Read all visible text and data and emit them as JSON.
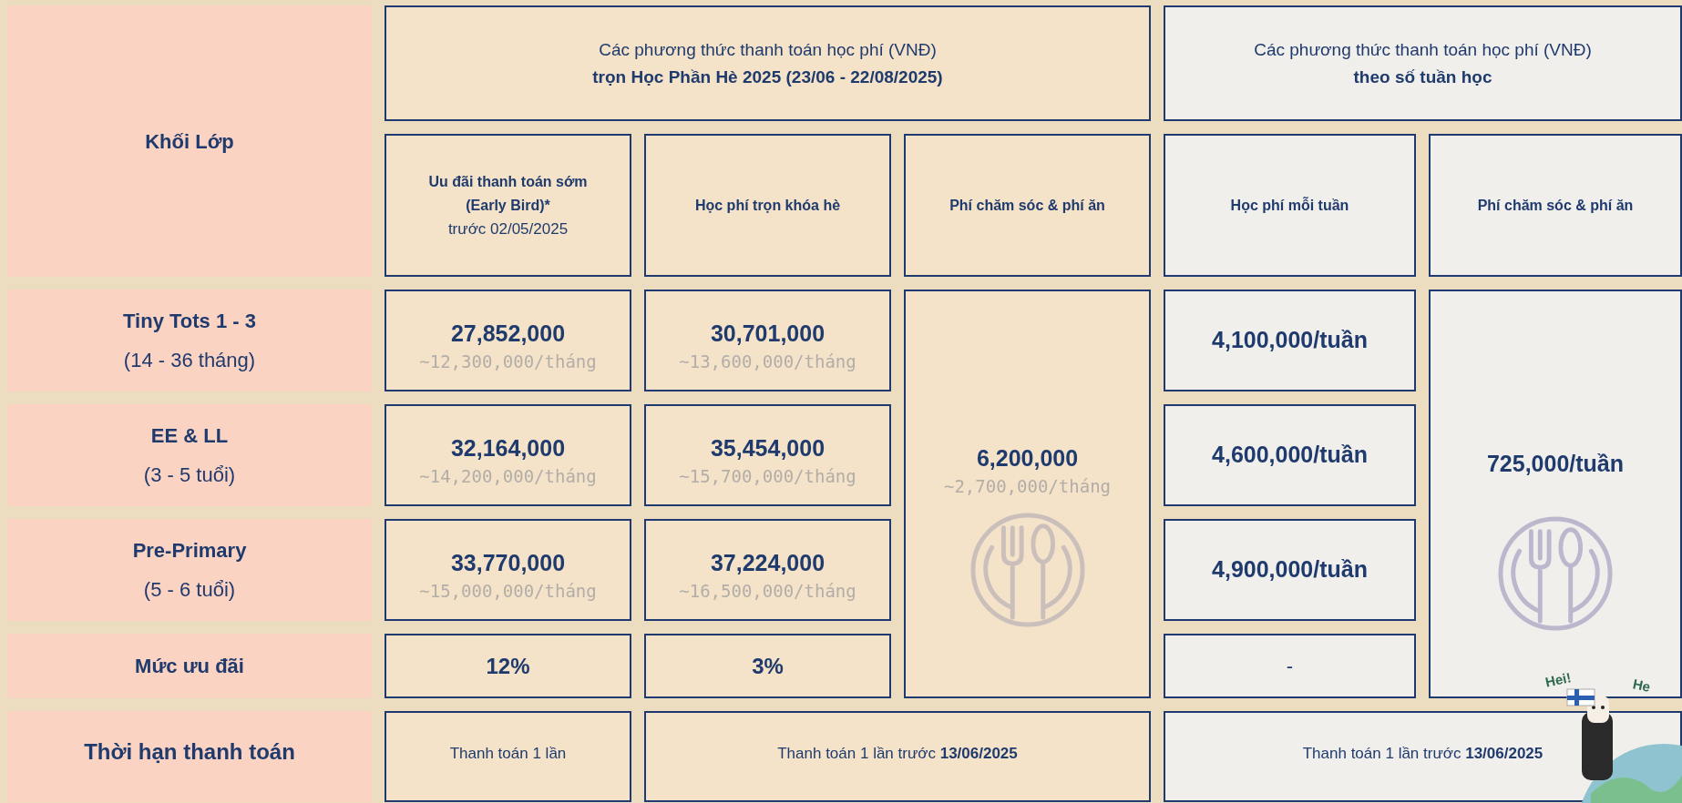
{
  "label_header": "Khối Lớp",
  "groups": [
    {
      "line1": "Các phương thức thanh toán học phí (VNĐ)",
      "line2": "trọn Học Phần Hè 2025 (23/06 - 22/08/2025)"
    },
    {
      "line1": "Các phương thức thanh toán học phí (VNĐ)",
      "line2": "theo số tuần học"
    }
  ],
  "columns": [
    {
      "title": "Uu đãi thanh toán sớm (Early Bird)*",
      "note": "trước 02/05/2025"
    },
    {
      "title": "Học phí trọn khóa hè"
    },
    {
      "title": "Phí chăm sóc & phí ăn"
    },
    {
      "title": "Học phí mỗi tuần"
    },
    {
      "title": "Phí chăm sóc & phí ăn"
    }
  ],
  "grades": [
    {
      "name": "Tiny Tots 1 - 3",
      "age": "(14 - 36 tháng)",
      "early": {
        "amount": "27,852,000",
        "monthly": "~12,300,000/tháng"
      },
      "full": {
        "amount": "30,701,000",
        "monthly": "~13,600,000/tháng"
      },
      "weekly": "4,100,000/tuần"
    },
    {
      "name": "EE & LL",
      "age": "(3 - 5 tuổi)",
      "early": {
        "amount": "32,164,000",
        "monthly": "~14,200,000/tháng"
      },
      "full": {
        "amount": "35,454,000",
        "monthly": "~15,700,000/tháng"
      },
      "weekly": "4,600,000/tuần"
    },
    {
      "name": "Pre-Primary",
      "age": "(5 - 6 tuổi)",
      "early": {
        "amount": "33,770,000",
        "monthly": "~15,000,000/tháng"
      },
      "full": {
        "amount": "37,224,000",
        "monthly": "~16,500,000/tháng"
      },
      "weekly": "4,900,000/tuần"
    }
  ],
  "care_summer": {
    "amount": "6,200,000",
    "monthly": "~2,700,000/tháng"
  },
  "care_weekly": {
    "amount": "725,000/tuần"
  },
  "discount": {
    "label": "Mức ưu đãi",
    "early": "12%",
    "full": "3%",
    "weekly": "-"
  },
  "deadline": {
    "label": "Thời hạn thanh toán",
    "early": "Thanh toán 1 lần",
    "summer": "Thanh toán 1 lần trước **13/06/2025**",
    "weekly": "Thanh toán 1 lần trước **13/06/2025**"
  },
  "mascot": {
    "bubbles": [
      "Hei!",
      "He"
    ]
  }
}
